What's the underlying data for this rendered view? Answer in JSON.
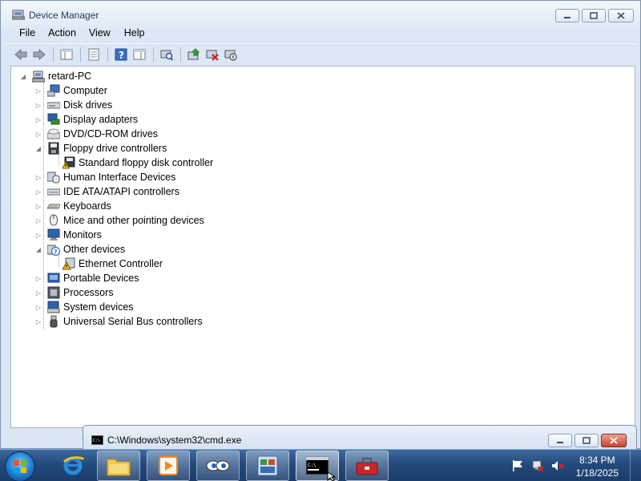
{
  "window": {
    "title": "Device Manager",
    "menu": [
      "File",
      "Action",
      "View",
      "Help"
    ]
  },
  "toolbar": {
    "icons": [
      "back-icon",
      "forward-icon",
      "show-hide-console-tree-icon",
      "properties-icon",
      "help-icon",
      "show-hide-action-pane-icon",
      "scan-hardware-icon",
      "update-driver-icon",
      "uninstall-icon",
      "disable-device-icon"
    ]
  },
  "tree": {
    "root": "retard-PC",
    "nodes": [
      {
        "label": "Computer",
        "icon": "computer-icon",
        "level": 1,
        "expanded": false
      },
      {
        "label": "Disk drives",
        "icon": "disk-drive-icon",
        "level": 1,
        "expanded": false
      },
      {
        "label": "Display adapters",
        "icon": "display-adapter-icon",
        "level": 1,
        "expanded": false
      },
      {
        "label": "DVD/CD-ROM drives",
        "icon": "dvd-drive-icon",
        "level": 1,
        "expanded": false
      },
      {
        "label": "Floppy drive controllers",
        "icon": "floppy-controller-icon",
        "level": 1,
        "expanded": true
      },
      {
        "label": "Standard floppy disk controller",
        "icon": "floppy-warning-icon",
        "level": 2
      },
      {
        "label": "Human Interface Devices",
        "icon": "hid-icon",
        "level": 1,
        "expanded": false
      },
      {
        "label": "IDE ATA/ATAPI controllers",
        "icon": "ide-controller-icon",
        "level": 1,
        "expanded": false
      },
      {
        "label": "Keyboards",
        "icon": "keyboard-icon",
        "level": 1,
        "expanded": false
      },
      {
        "label": "Mice and other pointing devices",
        "icon": "mouse-icon",
        "level": 1,
        "expanded": false
      },
      {
        "label": "Monitors",
        "icon": "monitor-icon",
        "level": 1,
        "expanded": false
      },
      {
        "label": "Other devices",
        "icon": "other-devices-icon",
        "level": 1,
        "expanded": true
      },
      {
        "label": "Ethernet Controller",
        "icon": "unknown-device-warning-icon",
        "level": 2
      },
      {
        "label": "Portable Devices",
        "icon": "portable-device-icon",
        "level": 1,
        "expanded": false
      },
      {
        "label": "Processors",
        "icon": "processor-icon",
        "level": 1,
        "expanded": false
      },
      {
        "label": "System devices",
        "icon": "system-device-icon",
        "level": 1,
        "expanded": false
      },
      {
        "label": "Universal Serial Bus controllers",
        "icon": "usb-icon",
        "level": 1,
        "expanded": false
      }
    ]
  },
  "cmd_window": {
    "title": "C:\\Windows\\system32\\cmd.exe"
  },
  "taskbar": {
    "items": [
      "start-orb",
      "internet-explorer-icon",
      "windows-explorer-icon",
      "media-player-icon",
      "eyes-app-icon",
      "control-panel-icon",
      "command-prompt-icon",
      "toolbox-icon"
    ],
    "clock_time": "8:34 PM",
    "clock_date": "1/18/2025"
  },
  "colors": {
    "window_frame": "#dbe6f3",
    "taskbar": "#234a7c",
    "warning": "#f4c000"
  }
}
